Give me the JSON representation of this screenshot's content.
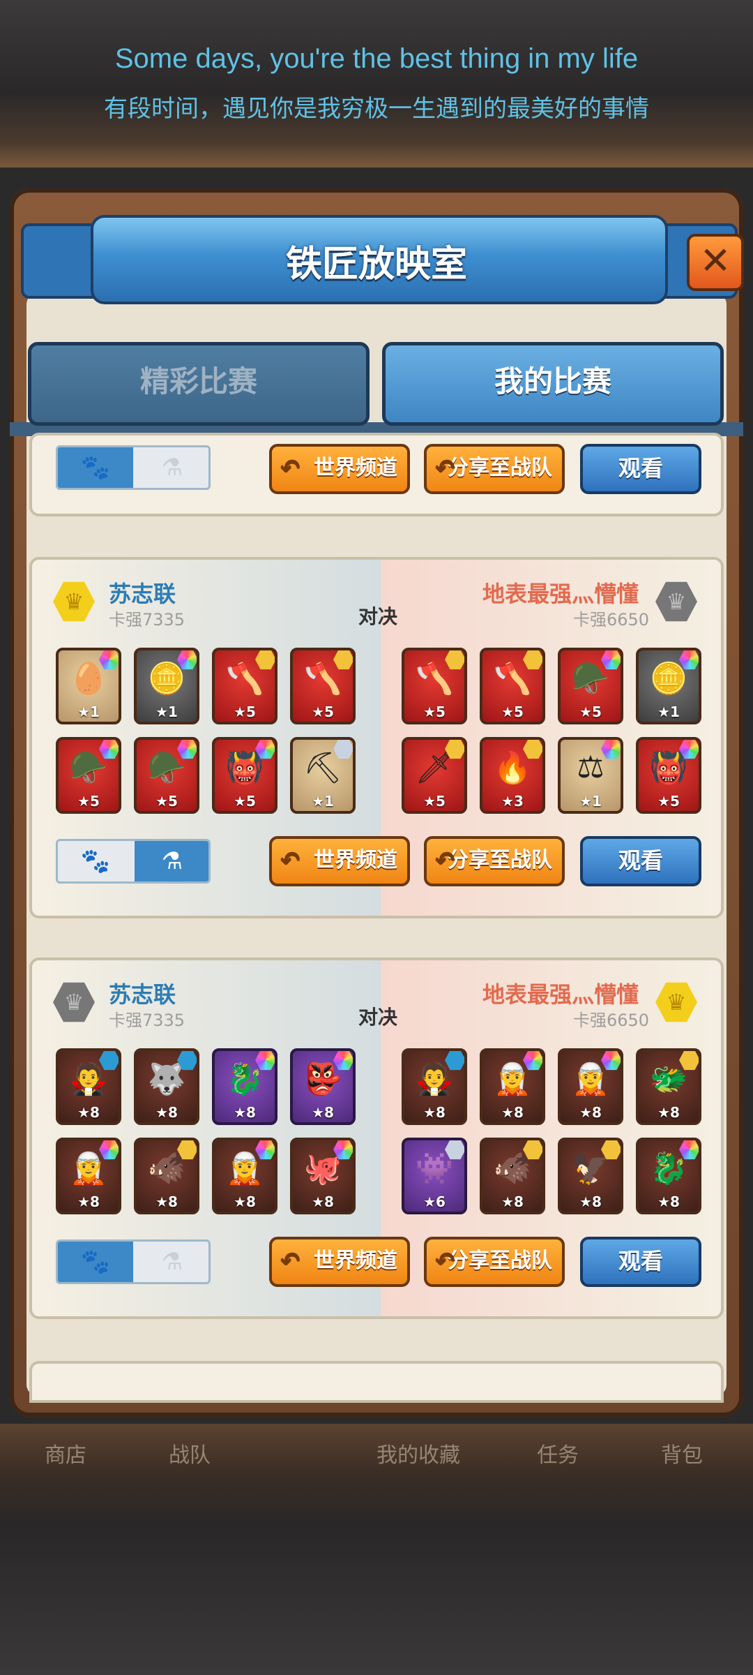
{
  "lyrics": {
    "line_en": "Some days, you're the best thing in my life",
    "line_zh": "有段时间，遇见你是我穷极一生遇到的最美好的事情"
  },
  "window": {
    "title": "铁匠放映室",
    "close_glyph": "✕"
  },
  "tabs": [
    {
      "label": "精彩比赛",
      "active": false
    },
    {
      "label": "我的比赛",
      "active": true
    }
  ],
  "common": {
    "world_channel": "世界频道",
    "share_team": "分享至战队",
    "watch": "观看",
    "vs": "对决",
    "paw_icon": "🐾",
    "potion_icon": "⚗"
  },
  "matches": [
    {
      "left": {
        "name": "苏志联",
        "rating": "卡强7335",
        "badge": "gold-crown"
      },
      "right": {
        "name": "地表最强灬懵懂",
        "rating": "卡强6650",
        "badge": "silver-crown"
      },
      "toggle_on": "potion",
      "left_units": [
        {
          "stars": "★1",
          "glyph": "🥚",
          "bg": "gold",
          "gem": "rainbow"
        },
        {
          "stars": "★1",
          "glyph": "🪙",
          "bg": "gray",
          "gem": "rainbow"
        },
        {
          "stars": "★5",
          "glyph": "🪓",
          "bg": "red",
          "gem": "gold"
        },
        {
          "stars": "★5",
          "glyph": "🪓",
          "bg": "red",
          "gem": "gold"
        },
        {
          "stars": "★5",
          "glyph": "🪖",
          "bg": "red",
          "gem": "rainbow"
        },
        {
          "stars": "★5",
          "glyph": "🪖",
          "bg": "red",
          "gem": "rainbow"
        },
        {
          "stars": "★5",
          "glyph": "👹",
          "bg": "red",
          "gem": "rainbow"
        },
        {
          "stars": "★1",
          "glyph": "⛏",
          "bg": "gold",
          "gem": "silver"
        }
      ],
      "right_units": [
        {
          "stars": "★5",
          "glyph": "🪓",
          "bg": "red",
          "gem": "gold"
        },
        {
          "stars": "★5",
          "glyph": "🪓",
          "bg": "red",
          "gem": "gold"
        },
        {
          "stars": "★5",
          "glyph": "🪖",
          "bg": "red",
          "gem": "rainbow"
        },
        {
          "stars": "★1",
          "glyph": "🪙",
          "bg": "gray",
          "gem": "rainbow"
        },
        {
          "stars": "★5",
          "glyph": "🗡",
          "bg": "red",
          "gem": "gold"
        },
        {
          "stars": "★3",
          "glyph": "🔥",
          "bg": "red",
          "gem": "gold"
        },
        {
          "stars": "★1",
          "glyph": "⚖",
          "bg": "gold",
          "gem": "rainbow"
        },
        {
          "stars": "★5",
          "glyph": "👹",
          "bg": "red",
          "gem": "rainbow"
        }
      ]
    },
    {
      "left": {
        "name": "苏志联",
        "rating": "卡强7335",
        "badge": "silver-crown"
      },
      "right": {
        "name": "地表最强灬懵懂",
        "rating": "卡强6650",
        "badge": "gold-crown"
      },
      "toggle_on": "paw",
      "left_units": [
        {
          "stars": "★8",
          "glyph": "🧛",
          "bg": "dark",
          "gem": "teal"
        },
        {
          "stars": "★8",
          "glyph": "🐺",
          "bg": "dark",
          "gem": "teal"
        },
        {
          "stars": "★8",
          "glyph": "🐉",
          "bg": "purple",
          "gem": "rainbow"
        },
        {
          "stars": "★8",
          "glyph": "👺",
          "bg": "purple",
          "gem": "rainbow"
        },
        {
          "stars": "★8",
          "glyph": "🧝",
          "bg": "dark",
          "gem": "rainbow"
        },
        {
          "stars": "★8",
          "glyph": "🐗",
          "bg": "dark",
          "gem": "gold"
        },
        {
          "stars": "★8",
          "glyph": "🧝",
          "bg": "dark",
          "gem": "rainbow"
        },
        {
          "stars": "★8",
          "glyph": "🐙",
          "bg": "dark",
          "gem": "rainbow"
        }
      ],
      "right_units": [
        {
          "stars": "★8",
          "glyph": "🧛",
          "bg": "dark",
          "gem": "teal"
        },
        {
          "stars": "★8",
          "glyph": "🧝",
          "bg": "dark",
          "gem": "rainbow"
        },
        {
          "stars": "★8",
          "glyph": "🧝",
          "bg": "dark",
          "gem": "rainbow"
        },
        {
          "stars": "★8",
          "glyph": "🐲",
          "bg": "dark",
          "gem": "gold"
        },
        {
          "stars": "★6",
          "glyph": "👾",
          "bg": "purple",
          "gem": "silver"
        },
        {
          "stars": "★8",
          "glyph": "🐗",
          "bg": "dark",
          "gem": "gold"
        },
        {
          "stars": "★8",
          "glyph": "🦅",
          "bg": "dark",
          "gem": "gold"
        },
        {
          "stars": "★8",
          "glyph": "🐉",
          "bg": "dark",
          "gem": "rainbow"
        }
      ]
    }
  ],
  "bottom_nav": [
    {
      "label": "商店"
    },
    {
      "label": "战队"
    },
    {
      "label": "我的收藏"
    },
    {
      "label": "任务"
    },
    {
      "label": "背包"
    }
  ]
}
